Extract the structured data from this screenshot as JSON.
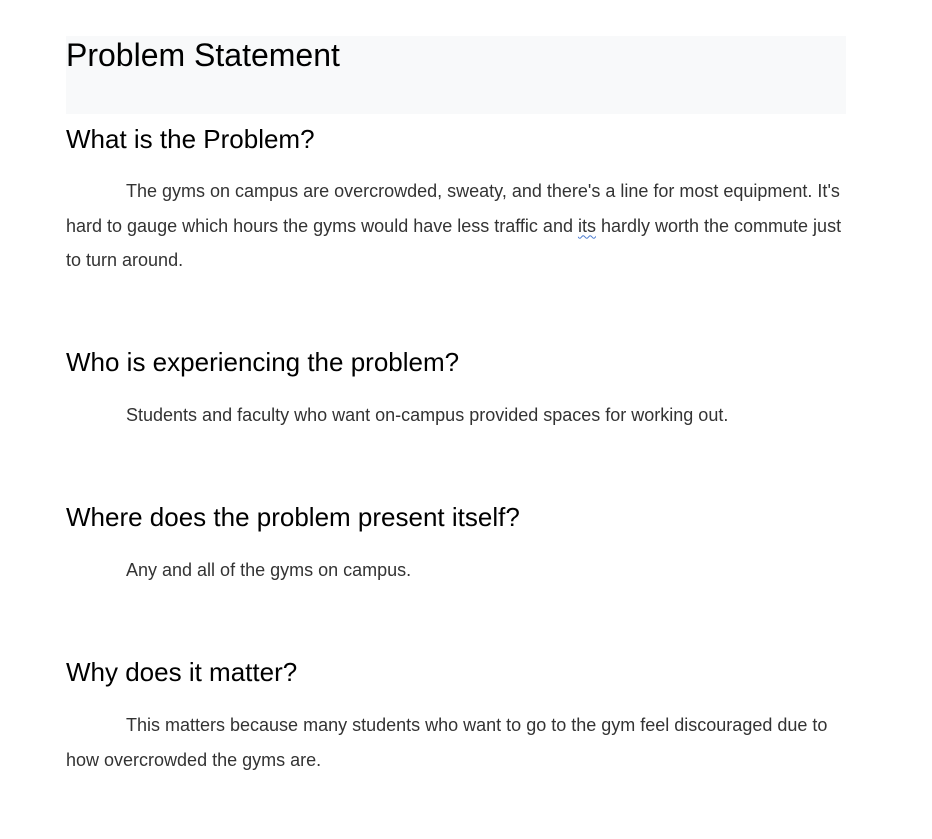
{
  "document": {
    "title": "Problem Statement",
    "sections": [
      {
        "heading": "What is the Problem?",
        "body_before_flag": "The gyms on campus are overcrowded, sweaty, and there's a line for most equipment. It's hard to gauge which hours the gyms would have less traffic and ",
        "flagged_word": "its",
        "body_after_flag": " hardly worth the commute just to turn around."
      },
      {
        "heading": "Who is experiencing the problem?",
        "body": "Students and faculty who want on-campus provided spaces for working out."
      },
      {
        "heading": "Where does the problem present itself?",
        "body": "Any and all of the gyms on campus."
      },
      {
        "heading": "Why does it matter?",
        "body": "This matters because many students who want to go to the gym feel discouraged due to how overcrowded the gyms are."
      }
    ]
  }
}
